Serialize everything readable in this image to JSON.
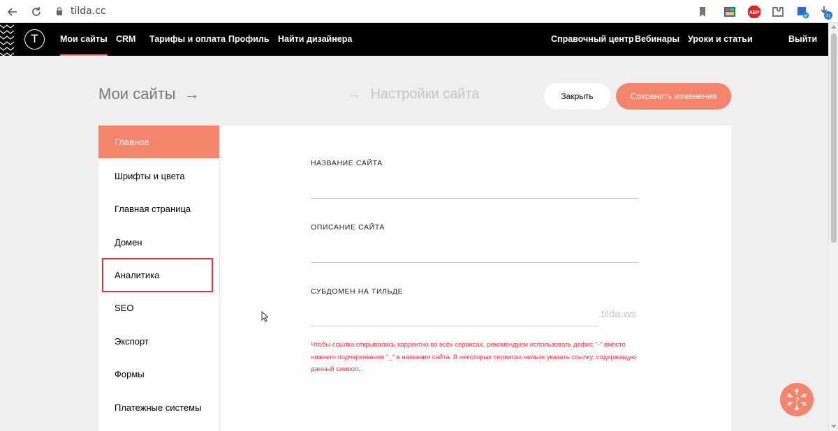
{
  "browser": {
    "url": "tilda.cc",
    "icons": [
      "back-icon",
      "reload-icon",
      "lock-icon",
      "bookmark-icon",
      "extension-icon",
      "adblock-icon",
      "puzzle-icon",
      "extension-badge-icon",
      "download-icon"
    ],
    "adblock_label": "ABP",
    "download_badge": "31"
  },
  "nav": {
    "logo_letter": "T",
    "left": [
      "Мои сайты",
      "CRM",
      "Тарифы и оплата",
      "Профиль",
      "Найти дизайнера"
    ],
    "right": [
      "Справочный центр",
      "Вебинары",
      "Уроки и статьи",
      "Выйти"
    ],
    "active_index": 0
  },
  "header": {
    "title": "Мои сайты",
    "title_arrow": "→",
    "crumb_arrow": "→",
    "crumb": "Настройки сайта",
    "close_label": "Закрыть",
    "save_label": "Сохранить изменения"
  },
  "sidebar": {
    "items": [
      "Главное",
      "Шрифты и цвета",
      "Главная страница",
      "Домен",
      "Аналитика",
      "SEO",
      "Экспорт",
      "Формы",
      "Платежные системы"
    ],
    "active_index": 0,
    "highlighted_index": 4
  },
  "form": {
    "site_name_label": "НАЗВАНИЕ САЙТА",
    "site_desc_label": "ОПИСАНИЕ САЙТА",
    "subdomain_label": "СУБДОМЕН НА ТИЛЬДЕ",
    "subdomain_suffix": ".tilda.ws",
    "hint": "Чтобы ссылка открывалась корректно во всех сервисах, рекомендуем использовать дефис \"-\" вместо нижнего подчеркивания \"_\" в названии сайта. В некоторых сервисах нельзя указать ссылку, содержащую данный символ."
  },
  "colors": {
    "accent": "#f4846b",
    "nav_bg": "#000000",
    "page_bg": "#efefef",
    "hint": "#e13c3c",
    "highlight_box": "#e03333"
  },
  "help": {
    "icon": "help-snowflake-icon",
    "symbol": "?"
  }
}
